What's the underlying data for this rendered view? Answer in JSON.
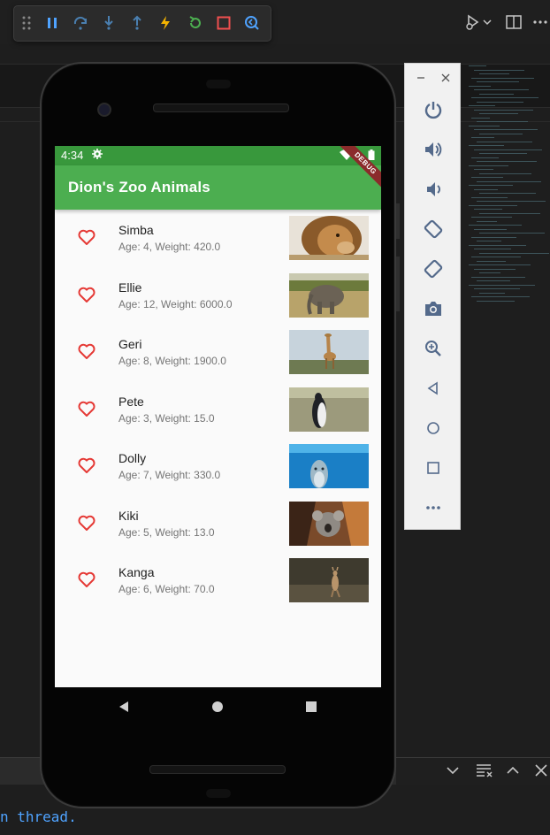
{
  "ide": {
    "terminal_line": "n thread."
  },
  "emulator_panel": {
    "buttons": [
      "power-icon",
      "volume-up-icon",
      "volume-down-icon",
      "rotate-left-icon",
      "rotate-right-icon",
      "screenshot-icon",
      "zoom-icon",
      "back-icon",
      "home-icon",
      "overview-icon",
      "more-icon"
    ]
  },
  "phone": {
    "status": {
      "time": "4:34"
    },
    "debug_banner": "DEBUG",
    "app_title": "Dion's Zoo Animals",
    "animals": [
      {
        "name": "Simba",
        "details": "Age: 4, Weight: 420.0"
      },
      {
        "name": "Ellie",
        "details": "Age: 12, Weight: 6000.0"
      },
      {
        "name": "Geri",
        "details": "Age: 8, Weight: 1900.0"
      },
      {
        "name": "Pete",
        "details": "Age: 3, Weight: 15.0"
      },
      {
        "name": "Dolly",
        "details": "Age: 7, Weight: 330.0"
      },
      {
        "name": "Kiki",
        "details": "Age: 5, Weight: 13.0"
      },
      {
        "name": "Kanga",
        "details": "Age: 6, Weight: 70.0"
      }
    ],
    "colors": {
      "status_bar": "#38983c",
      "app_bar": "#4cae50",
      "heart": "#e53935"
    }
  }
}
